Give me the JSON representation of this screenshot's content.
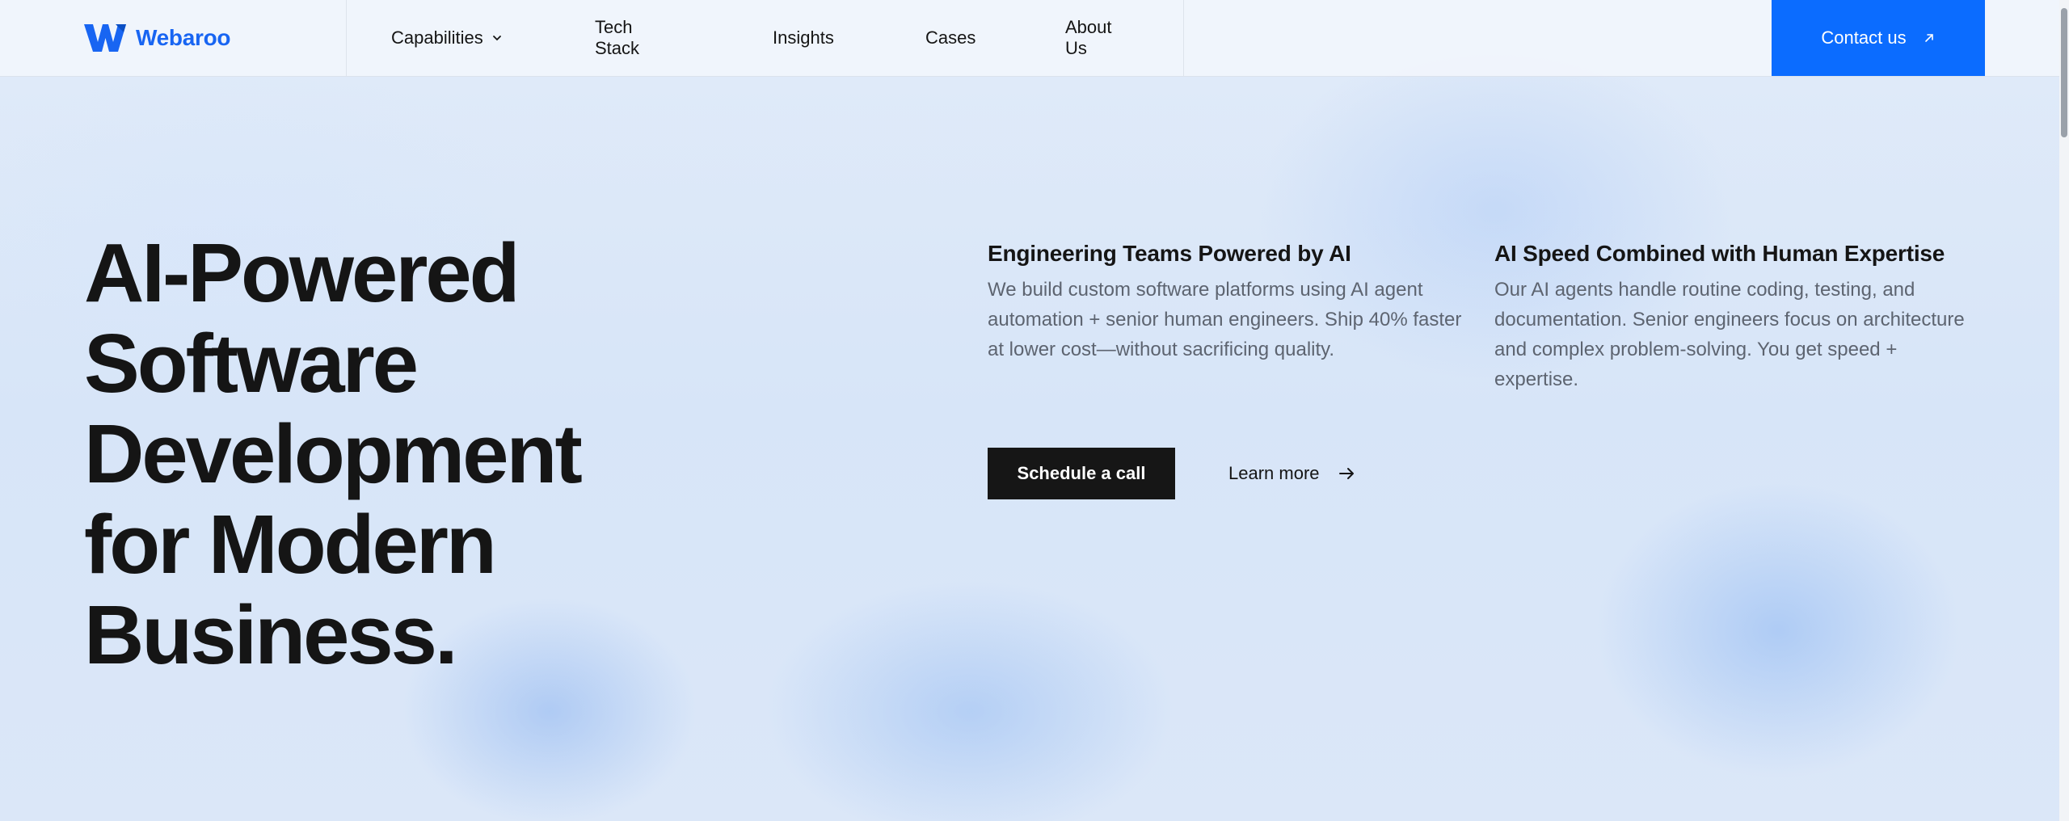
{
  "brand": {
    "name": "Webaroo",
    "color": "#1865f2"
  },
  "nav": {
    "items": [
      {
        "label": "Capabilities",
        "has_dropdown": true
      },
      {
        "label": "Tech Stack"
      },
      {
        "label": "Insights"
      },
      {
        "label": "Cases"
      },
      {
        "label": "About Us"
      }
    ],
    "contact_label": "Contact us",
    "contact_color": "#0b6cff"
  },
  "hero": {
    "title_lines": [
      "AI-Powered",
      "Software",
      "Development",
      "for Modern",
      "Business."
    ]
  },
  "features": [
    {
      "title": "Engineering Teams Powered by AI",
      "text": "We build custom software platforms using AI agent automation + senior human engineers. Ship 40% faster at lower cost—without sacrificing quality."
    },
    {
      "title": "AI Speed Combined with Human Expertise",
      "text": "Our AI agents handle routine coding, testing, and documentation. Senior engineers focus on architecture and complex problem-solving. You get speed + expertise."
    }
  ],
  "cta": {
    "primary_label": "Schedule a call",
    "secondary_label": "Learn more"
  },
  "icons": {
    "logo": "webaroo-w-logo",
    "dropdown": "chevron-down-icon",
    "contact": "arrow-up-right-icon",
    "learn_more": "arrow-right-icon"
  }
}
